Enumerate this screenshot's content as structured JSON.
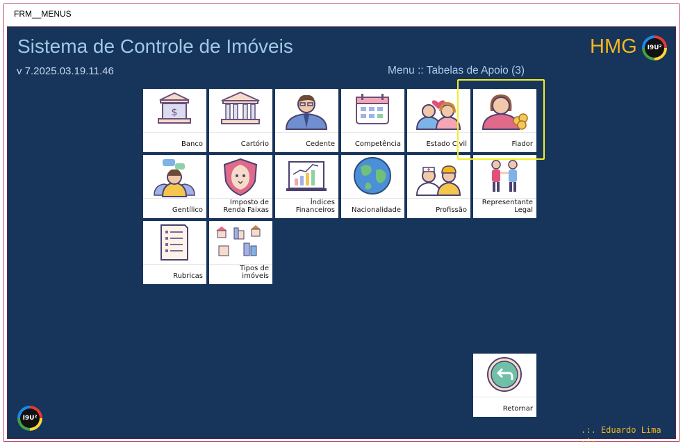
{
  "window": {
    "title": "FRM__MENUS"
  },
  "header": {
    "app_title": "Sistema de Controle de Imóveis",
    "version": "v 7.2025.03.19.11.46",
    "menu_path": "Menu :: Tabelas de Apoio (3)",
    "env_label": "HMG",
    "logo_text": "I9U²"
  },
  "tiles": [
    {
      "id": "banco",
      "label": "Banco",
      "icon": "bank-icon"
    },
    {
      "id": "cartorio",
      "label": "Cartório",
      "icon": "courthouse-icon"
    },
    {
      "id": "cedente",
      "label": "Cedente",
      "icon": "businessman-icon"
    },
    {
      "id": "competencia",
      "label": "Competência",
      "icon": "calendar-icon"
    },
    {
      "id": "estado-civil",
      "label": "Estado Civil",
      "icon": "couple-heart-icon"
    },
    {
      "id": "fiador",
      "label": "Fiador",
      "icon": "woman-coins-icon"
    },
    {
      "id": "gentilico",
      "label": "Gentílico",
      "icon": "people-speech-icon"
    },
    {
      "id": "imposto-renda",
      "label": "Imposto de Renda Faixas",
      "icon": "lion-shield-icon"
    },
    {
      "id": "indices",
      "label": "Índices Financeiros",
      "icon": "chart-board-icon"
    },
    {
      "id": "nacionalidade",
      "label": "Nacionalidade",
      "icon": "globe-icon"
    },
    {
      "id": "profissao",
      "label": "Profissão",
      "icon": "workers-icon"
    },
    {
      "id": "representante",
      "label": "Representante Legal",
      "icon": "handshake-people-icon"
    },
    {
      "id": "rubricas",
      "label": "Rubricas",
      "icon": "document-list-icon"
    },
    {
      "id": "tipos-imoveis",
      "label": "Tipos de imóveis",
      "icon": "buildings-icon"
    }
  ],
  "return_button": {
    "label": "Retornar",
    "icon": "back-arrow-icon"
  },
  "footer": {
    "user": ".:. Eduardo Lima .:."
  },
  "colors": {
    "background": "#17345b",
    "title": "#9fc9e4",
    "accent": "#f5b81c",
    "highlight": "#f3ef2a"
  }
}
